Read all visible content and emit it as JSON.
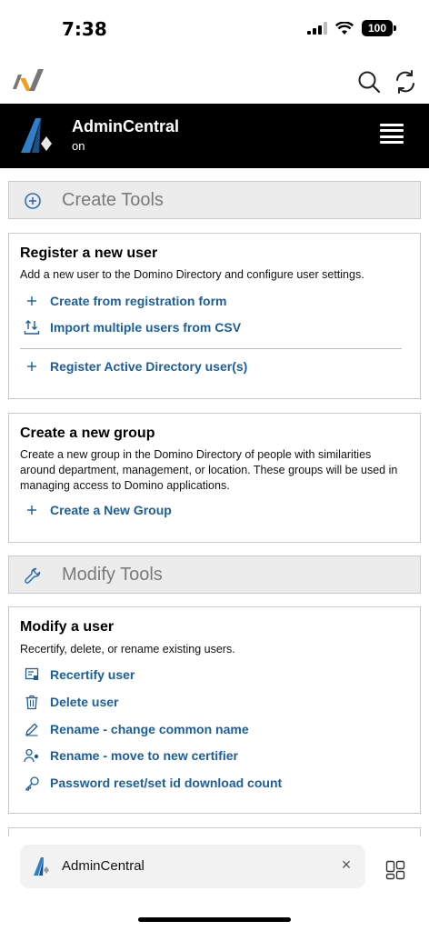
{
  "status": {
    "time": "7:38",
    "battery": "100"
  },
  "app": {
    "title": "AdminCentral",
    "subtitle": "on"
  },
  "create_section": {
    "title": "Create Tools"
  },
  "register_card": {
    "title": "Register a new user",
    "description": "Add a new user to the Domino Directory and configure user settings.",
    "actions": [
      {
        "label": "Create from registration form",
        "icon": "plus-icon"
      },
      {
        "label": "Import multiple users from CSV",
        "icon": "import-icon"
      },
      {
        "label": "Register Active Directory user(s)",
        "icon": "plus-icon"
      }
    ]
  },
  "group_card": {
    "title": "Create a new group",
    "description": "Create a new group in the Domino Directory of people with similarities around department, management, or location.  These groups will be used in managing access to Domino applications.",
    "actions": [
      {
        "label": "Create a New Group",
        "icon": "plus-icon"
      }
    ]
  },
  "modify_section": {
    "title": "Modify Tools"
  },
  "modify_card": {
    "title": "Modify a user",
    "description": "Recertify, delete, or rename existing users.",
    "actions": [
      {
        "label": "Recertify user",
        "icon": "certificate-icon"
      },
      {
        "label": "Delete user",
        "icon": "trash-icon"
      },
      {
        "label": "Rename - change common name",
        "icon": "pencil-icon"
      },
      {
        "label": "Rename - move to new certifier",
        "icon": "user-move-icon"
      },
      {
        "label": "Password reset/set id download count",
        "icon": "key-icon"
      }
    ]
  },
  "bottom_tab": {
    "label": "AdminCentral",
    "close": "×"
  },
  "colors": {
    "link": "#1a5e9e",
    "header_bg": "#000000",
    "section_bg": "#ececec"
  }
}
